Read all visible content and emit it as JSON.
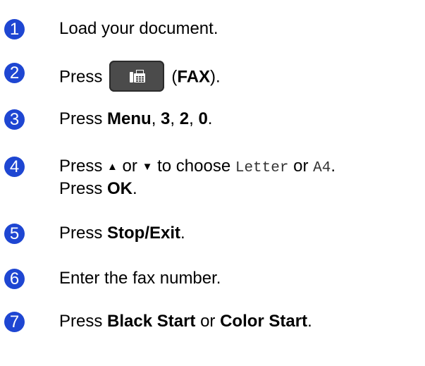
{
  "steps": [
    {
      "number": "1",
      "text": "Load your document."
    },
    {
      "number": "2",
      "before": "Press",
      "button_icon": "fax-icon",
      "paren_open": "(",
      "bold": "FAX",
      "paren_close": ")."
    },
    {
      "number": "3",
      "t1": "Press ",
      "b1": "Menu",
      "t2": ", ",
      "b2": "3",
      "t3": ", ",
      "b3": "2",
      "t4": ", ",
      "b4": "0",
      "t5": "."
    },
    {
      "number": "4",
      "t1": "Press ",
      "up": "▲",
      "t2": " or ",
      "down": "▼",
      "t3": " to choose ",
      "m1": "Letter",
      "t4": " or ",
      "m2": "A4",
      "t5": ".",
      "line2_t1": "Press ",
      "line2_b1": "OK",
      "line2_t2": "."
    },
    {
      "number": "5",
      "t1": "Press ",
      "b1": "Stop/Exit",
      "t2": "."
    },
    {
      "number": "6",
      "text": "Enter the fax number."
    },
    {
      "number": "7",
      "t1": "Press ",
      "b1": "Black Start",
      "t2": " or ",
      "b2": "Color Start",
      "t3": "."
    }
  ],
  "colors": {
    "step_badge": "#1e46d2",
    "button_bg": "#4b4b4b"
  }
}
